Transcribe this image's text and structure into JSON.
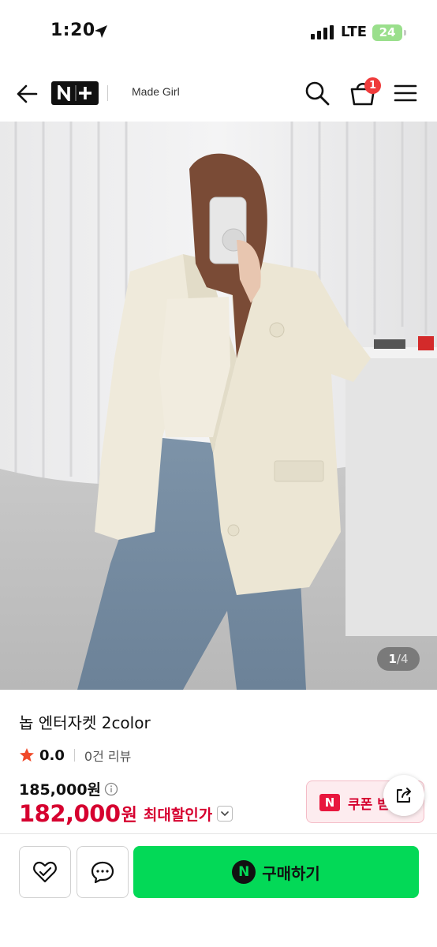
{
  "status_bar": {
    "time": "1:20",
    "network": "LTE",
    "battery": "24"
  },
  "nav": {
    "logo_text": "N+",
    "shop_name": "Made Girl",
    "cart_count": "1"
  },
  "image_viewer": {
    "current": "1",
    "total": "/4"
  },
  "product": {
    "title": "놉 엔터자켓 2color",
    "rating": "0.0",
    "review_count": "0건 리뷰",
    "original_price": "185,000원",
    "sale_price": "182,000",
    "sale_unit": "원",
    "max_discount_label": "최대할인가",
    "coupon_label": "쿠폰 받"
  },
  "bottom_bar": {
    "buy_label": "구매하기",
    "buy_brand": "N"
  },
  "colors": {
    "accent_green": "#03d957",
    "price_red": "#d6002f",
    "badge_red": "#ef3b3b",
    "star_red": "#f04a2a"
  }
}
